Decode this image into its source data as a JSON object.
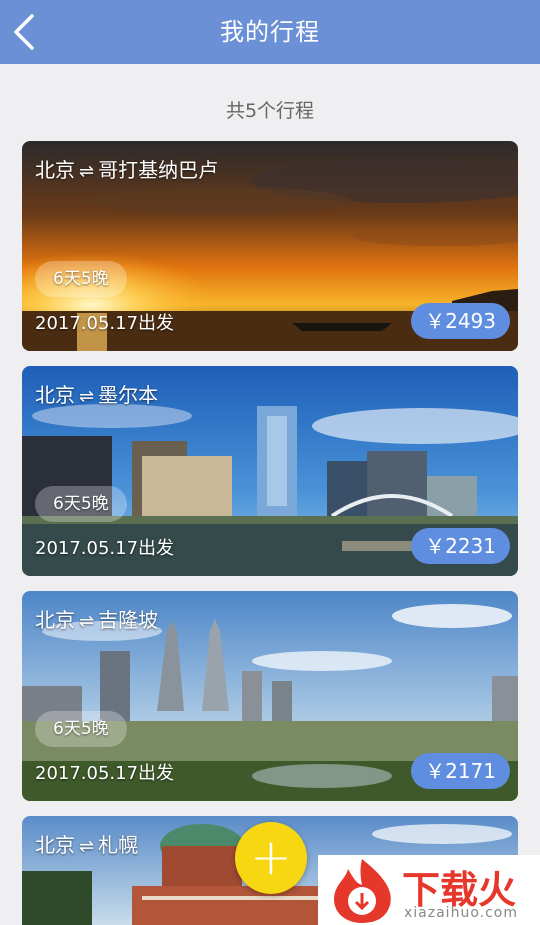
{
  "header": {
    "title": "我的行程",
    "back_icon": "chevron-left-icon"
  },
  "summary": "共5个行程",
  "trips": [
    {
      "from": "北京",
      "to": "哥打基纳巴卢",
      "duration": "6天5晚",
      "date": "2017.05.17出发",
      "price": "￥2493"
    },
    {
      "from": "北京",
      "to": "墨尔本",
      "duration": "6天5晚",
      "date": "2017.05.17出发",
      "price": "￥2231"
    },
    {
      "from": "北京",
      "to": "吉隆坡",
      "duration": "6天5晚",
      "date": "2017.05.17出发",
      "price": "￥2171"
    },
    {
      "from": "北京",
      "to": "札幌"
    }
  ],
  "fab": {
    "label": "+"
  },
  "watermark": {
    "text": "下载火",
    "url": "xiazaihuo.com"
  },
  "colors": {
    "header": "#6b90d6",
    "price_badge": "#5f8de0",
    "fab": "#f7d711",
    "background": "#efeff1"
  }
}
